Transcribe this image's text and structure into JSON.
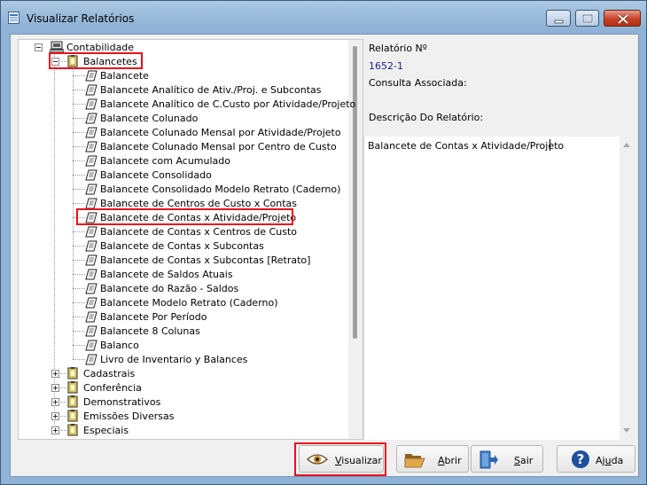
{
  "window": {
    "title": "Visualizar Relatórios"
  },
  "tree": {
    "root_label": "Contabilidade",
    "balancetes_label": "Balancetes",
    "reports": [
      "Balancete",
      "Balancete Analítico de Ativ./Proj. e Subcontas",
      "Balancete Analítico de C.Custo por Atividade/Projeto",
      "Balancete Colunado",
      "Balancete Colunado Mensal por Atividade/Projeto",
      "Balancete Colunado Mensal por Centro de Custo",
      "Balancete com Acumulado",
      "Balancete Consolidado",
      "Balancete Consolidado Modelo Retrato (Caderno)",
      "Balancete de Centros de Custo x Contas",
      "Balancete de Contas x Atividade/Projeto",
      "Balancete de Contas x Centros de Custo",
      "Balancete de Contas x Subcontas",
      "Balancete de Contas x Subcontas [Retrato]",
      "Balancete de Saldos Atuais",
      "Balancete do Razão - Saldos",
      "Balancete Modelo Retrato (Caderno)",
      "Balancete Por Período",
      "Balancete 8 Colunas",
      "Balanco",
      "Livro de Inventario y Balances"
    ],
    "selected_report_index": 10,
    "other_folders": [
      "Cadastrais",
      "Conferência",
      "Demonstrativos",
      "Emissões Diversas",
      "Especiais"
    ]
  },
  "info": {
    "relatorio_label": "Relatório Nº",
    "relatorio_value": "1652-1",
    "consulta_label": "Consulta Associada:",
    "descricao_label": "Descrição Do Relatório:",
    "descricao_text": "Balancete de Contas x Atividade/Projeto"
  },
  "buttons": {
    "visualizar_underline": "V",
    "visualizar_rest": "isualizar",
    "abrir_underline": "A",
    "abrir_rest": "brir",
    "sair_underline": "S",
    "sair_rest": "air",
    "ajuda_prefix": "Aj",
    "ajuda_underline": "u",
    "ajuda_rest": "da"
  },
  "colors": {
    "highlight_box": "#e8101d",
    "accent_blue": "#1a1a8a"
  }
}
